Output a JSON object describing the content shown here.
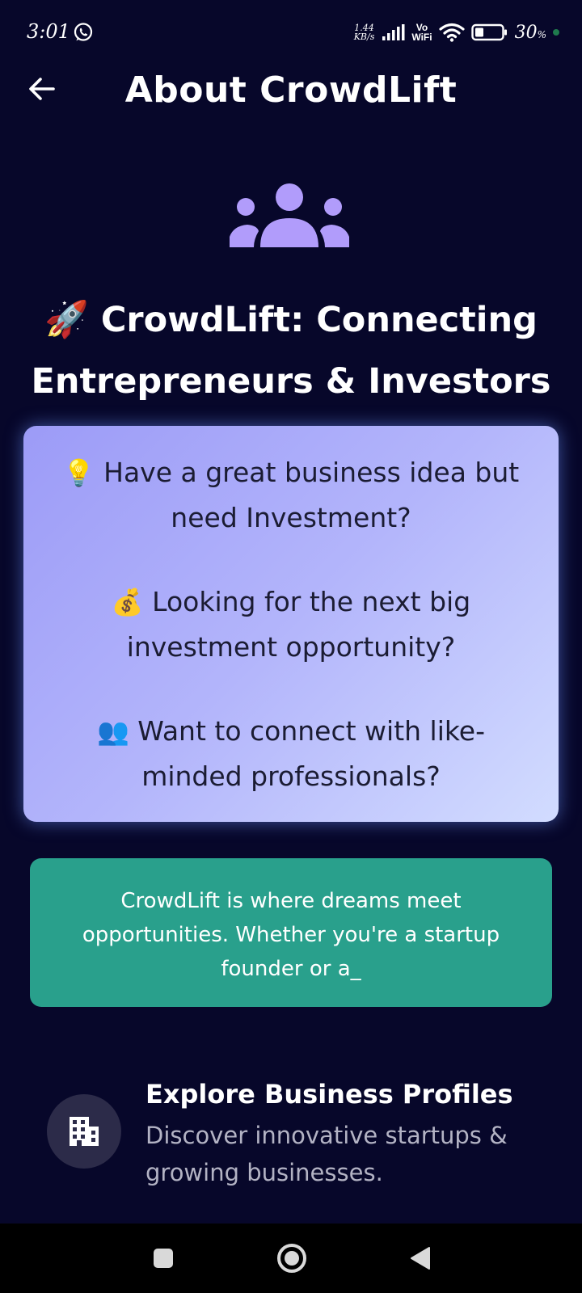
{
  "status_bar": {
    "time": "3:01",
    "net_speed_value": "1.44",
    "net_speed_unit": "KB/s",
    "vowifi_top": "Vo",
    "vowifi_bottom": "WiFi",
    "battery_percent": "30",
    "battery_unit": "%"
  },
  "header": {
    "title": "About CrowdLift",
    "back_icon": "arrow-left-icon"
  },
  "hero": {
    "icon": "users-group-icon",
    "icon_color": "#b19cfb",
    "emoji": "🚀",
    "headline": "CrowdLift: Connecting Entrepreneurs & Investors"
  },
  "questions": [
    {
      "emoji": "💡",
      "text": "Have a great business idea but need Investment?"
    },
    {
      "emoji": "💰",
      "text": "Looking for the next big investment opportunity?"
    },
    {
      "emoji": "👥",
      "text": "Want to connect with like-minded professionals?"
    }
  ],
  "intro": {
    "text": "CrowdLift is where dreams meet opportunities. Whether you're a startup founder or a_",
    "background": "#29a08c"
  },
  "features": [
    {
      "icon": "building-icon",
      "title": "Explore Business Profiles",
      "description": "Discover innovative startups & growing businesses."
    }
  ],
  "nav_bar": {
    "recents_icon": "square-icon",
    "home_icon": "circle-home-icon",
    "back_icon": "triangle-back-icon"
  },
  "colors": {
    "background": "#07072a",
    "card_gradient_start": "#9c9bf7",
    "card_gradient_end": "#d2dcff"
  }
}
